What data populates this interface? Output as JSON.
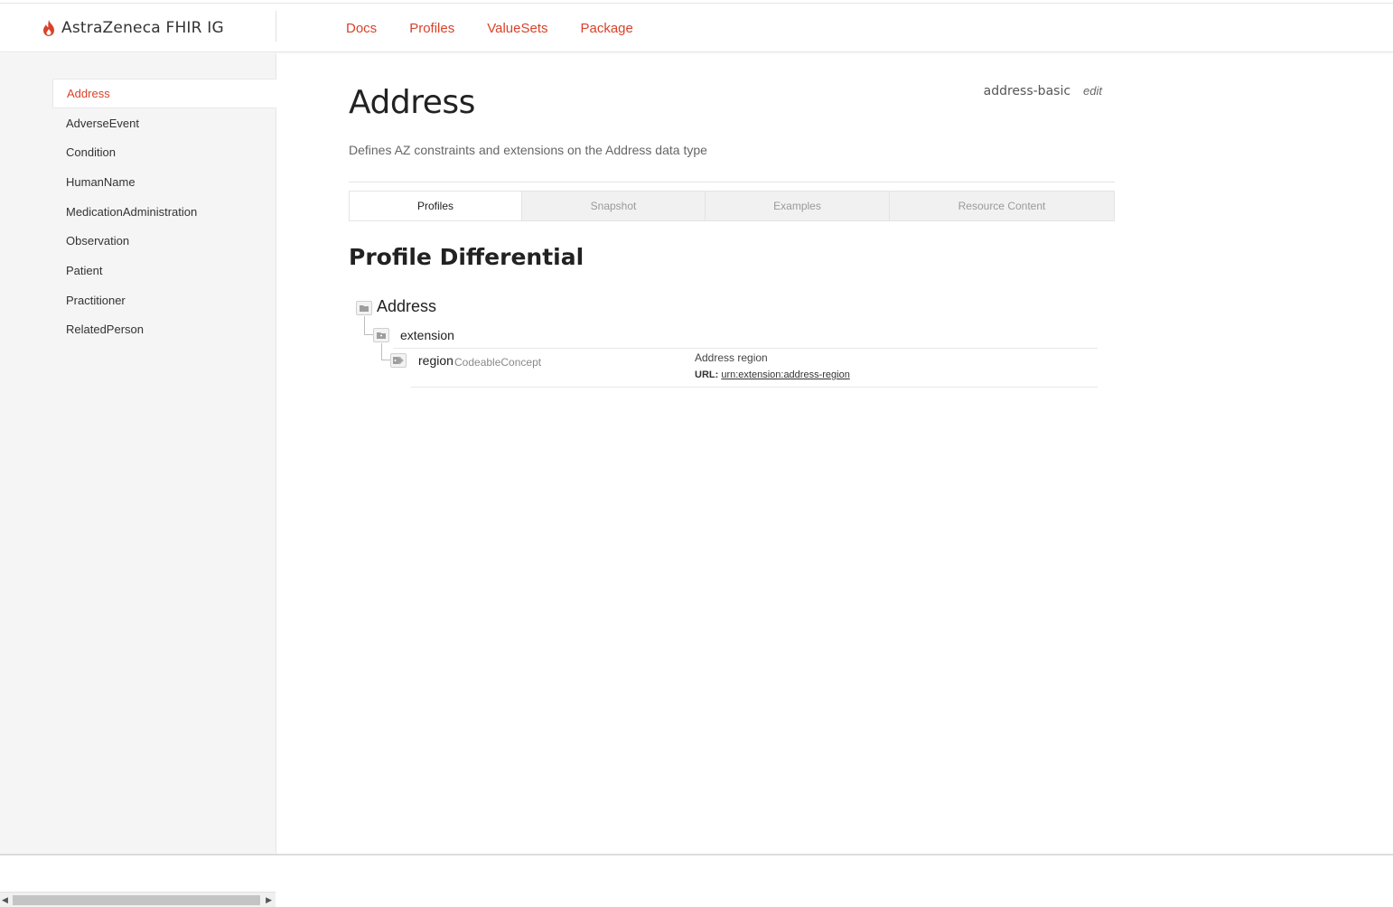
{
  "header": {
    "brand": "AstraZeneca FHIR IG",
    "nav": [
      "Docs",
      "Profiles",
      "ValueSets",
      "Package"
    ]
  },
  "sidebar": {
    "items": [
      {
        "label": "Address",
        "active": true
      },
      {
        "label": "AdverseEvent"
      },
      {
        "label": "Condition"
      },
      {
        "label": "HumanName"
      },
      {
        "label": "MedicationAdministration"
      },
      {
        "label": "Observation"
      },
      {
        "label": "Patient"
      },
      {
        "label": "Practitioner"
      },
      {
        "label": "RelatedPerson"
      }
    ]
  },
  "page": {
    "title": "Address",
    "profile_id": "address-basic",
    "edit_label": "edit",
    "description": "Defines AZ constraints and extensions on the Address data type",
    "tabs": [
      {
        "label": "Profiles",
        "active": true
      },
      {
        "label": "Snapshot"
      },
      {
        "label": "Examples"
      },
      {
        "label": "Resource Content"
      }
    ],
    "section_title": "Profile Differential"
  },
  "tree": {
    "root": {
      "label": "Address",
      "icon": "folder-icon"
    },
    "extension": {
      "label": "extension",
      "icon": "extension-icon"
    },
    "region": {
      "label": "region",
      "type": "CodeableConcept",
      "icon": "tag-icon",
      "short": "Address region",
      "url_label": "URL:",
      "url": "urn:extension:address-region"
    }
  },
  "colors": {
    "accent": "#d9422a",
    "sidebar_bg": "#f5f5f5"
  }
}
